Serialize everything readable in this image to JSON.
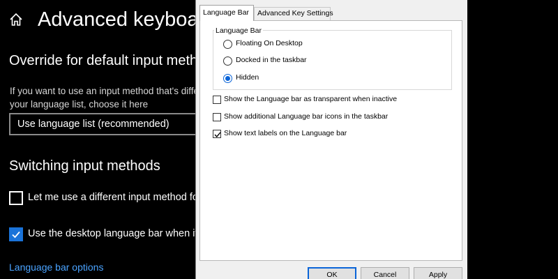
{
  "settings": {
    "title": "Advanced keyboard",
    "section_override": "Override for default input metho",
    "override_desc_line1": "If you want to use an input method that's diffe",
    "override_desc_line2": "your language list, choose it here",
    "input_method_value": "Use language list (recommended)",
    "section_switching": "Switching input methods",
    "checkbox_different_method": {
      "label": "Let me use a different input method for e",
      "checked": false
    },
    "checkbox_desktop_bar": {
      "label": "Use the desktop language bar when it's a",
      "checked": true
    },
    "link_language_bar_options": "Language bar options",
    "accent_color": "#1a73d9"
  },
  "dialog": {
    "tabs": [
      "Language Bar",
      "Advanced Key Settings"
    ],
    "active_tab": "Language Bar",
    "group_title": "Language Bar",
    "radios": [
      {
        "label": "Floating On Desktop",
        "selected": false
      },
      {
        "label": "Docked in the taskbar",
        "selected": false
      },
      {
        "label": "Hidden",
        "selected": true
      }
    ],
    "checkboxes": [
      {
        "label": "Show the Language bar as transparent when inactive",
        "checked": false
      },
      {
        "label": "Show additional Language bar icons in the taskbar",
        "checked": false
      },
      {
        "label": "Show text labels on the Language bar",
        "checked": true
      }
    ],
    "buttons": {
      "ok": "OK",
      "cancel": "Cancel",
      "apply": "Apply"
    }
  }
}
